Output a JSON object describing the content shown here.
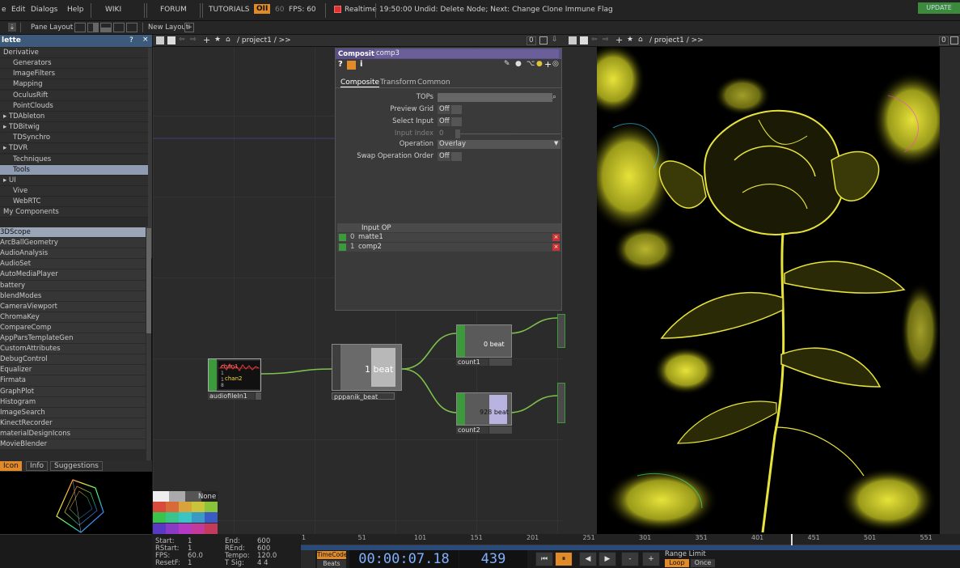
{
  "menu": {
    "items": [
      "e",
      "Edit",
      "Dialogs",
      "Help",
      "WIKI",
      "FORUM",
      "TUTORIALS"
    ],
    "oi": "OII",
    "fps_num": "60",
    "fps": "FPS: 60",
    "realtime": "Realtime",
    "status": "19:50:00 Undid: Delete Node; Next: Change Clone Immune Flag",
    "update": "UPDATE"
  },
  "toolbar": {
    "pane_layout": "Pane Layout",
    "new_layout": "New Layout"
  },
  "palette": {
    "title": "lette",
    "help": "?",
    "close": "×",
    "categories": [
      {
        "label": "Derivative",
        "cat": true
      },
      {
        "label": "Generators"
      },
      {
        "label": "ImageFilters"
      },
      {
        "label": "Mapping"
      },
      {
        "label": "OculusRift"
      },
      {
        "label": "PointClouds"
      },
      {
        "label": "▸ TDAbleton",
        "cat": true
      },
      {
        "label": "▸ TDBitwig",
        "cat": true
      },
      {
        "label": "TDSynchro"
      },
      {
        "label": "▸ TDVR",
        "cat": true
      },
      {
        "label": "Techniques"
      },
      {
        "label": "Tools",
        "sel": true
      },
      {
        "label": "▸ UI",
        "cat": true
      },
      {
        "label": "Vive"
      },
      {
        "label": "WebRTC"
      },
      {
        "label": "My Components",
        "cat": true
      }
    ],
    "components": [
      "3DScope",
      "ArcBallGeometry",
      "AudioAnalysis",
      "AudioSet",
      "AutoMediaPlayer",
      "battery",
      "blendModes",
      "CameraViewport",
      "ChromaKey",
      "CompareComp",
      "AppParsTemplateGen",
      "CustomAttributes",
      "DebugControl",
      "Equalizer",
      "Firmata",
      "GraphPlot",
      "Histogram",
      "ImageSearch",
      "KinectRecorder",
      "materialDesignIcons",
      "MovieBlender"
    ],
    "tabs": [
      "Icon",
      "Info",
      "Suggestions"
    ]
  },
  "network": {
    "path": "/ project1 / >>",
    "viewer_path": "/ project1 / >>",
    "zero": "0"
  },
  "params": {
    "type": "Composite",
    "name": "comp3",
    "tabs": [
      "Composite",
      "Transform",
      "Common"
    ],
    "rows": [
      {
        "label": "TOPs",
        "value": ""
      },
      {
        "label": "Preview Grid",
        "value": "Off"
      },
      {
        "label": "Select Input",
        "value": "Off"
      },
      {
        "label": "Input Index",
        "value": "0"
      },
      {
        "label": "Operation",
        "value": "Overlay"
      },
      {
        "label": "Swap Operation Order",
        "value": "Off"
      }
    ],
    "input_header": "Input OP",
    "inputs": [
      {
        "idx": "0",
        "name": "matte1"
      },
      {
        "idx": "1",
        "name": "comp2"
      }
    ]
  },
  "nodes": {
    "audio": {
      "label": "audiofileIn1",
      "text1": "chan1",
      "text2": "chan2",
      "vals": [
        "1",
        "1",
        "8"
      ]
    },
    "beat": {
      "label": "pppanik_beat",
      "text": "1 beat"
    },
    "count1": {
      "label": "count1",
      "text": "0 beat"
    },
    "count2": {
      "label": "count2",
      "text": "928 beat"
    }
  },
  "swatches": {
    "none": "None"
  },
  "timeline": {
    "start_label": "Start:",
    "start": "1",
    "end_label": "End:",
    "end": "600",
    "rstart_label": "RStart:",
    "rstart": "1",
    "rend_label": "REnd:",
    "rend": "600",
    "fps_label": "FPS:",
    "fps": "60.0",
    "tempo_label": "Tempo:",
    "tempo": "120.0",
    "resetf_label": "ResetF:",
    "resetf": "1",
    "tsig_label": "T Sig:",
    "tsig": "4    4",
    "ticks": [
      "1",
      "51",
      "101",
      "151",
      "201",
      "251",
      "301",
      "351",
      "401",
      "451",
      "501",
      "551"
    ],
    "timecode_btn": "TimeCode",
    "beats_btn": "Beats",
    "timecode": "00:00:07.18",
    "frame": "439",
    "range_limit": "Range Limit",
    "loop": "Loop",
    "once": "Once"
  },
  "colors": {
    "accent": "#e08a2a",
    "node_green": "#3c9a3c",
    "selected_blue": "#8e9bb0",
    "param_header": "#5a4f86"
  }
}
